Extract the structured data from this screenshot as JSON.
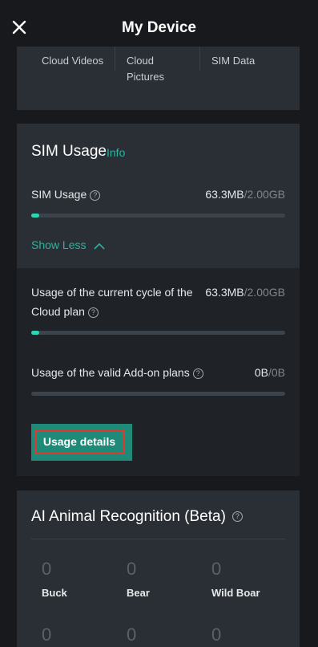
{
  "header": {
    "title": "My Device"
  },
  "cloud": {
    "columns": [
      {
        "label": "Cloud Videos"
      },
      {
        "label_line1": "Cloud",
        "label_line2": "Pictures"
      },
      {
        "label": "SIM Data"
      }
    ]
  },
  "sim": {
    "title": "SIM Usage",
    "info_label": "Info",
    "usage_label": "SIM Usage",
    "usage_used": "63.3MB",
    "usage_total": "/2.00GB",
    "usage_fraction": 0.031,
    "show_less_label": "Show Less",
    "cycle_label_line1": "Usage of the current cycle of the",
    "cycle_label_line2": "Cloud plan",
    "cycle_used": "63.3MB",
    "cycle_total": "/2.00GB",
    "cycle_fraction": 0.031,
    "addon_label": "Usage of the valid Add-on plans",
    "addon_used": "0B",
    "addon_total": "/0B",
    "addon_fraction": 0,
    "usage_details_label": "Usage details"
  },
  "ai": {
    "title": "AI Animal Recognition (Beta)",
    "animals": [
      {
        "name": "Buck",
        "count": "0"
      },
      {
        "name": "Bear",
        "count": "0"
      },
      {
        "name": "Wild Boar",
        "count": "0"
      }
    ],
    "next_row_counts": [
      "0",
      "0",
      "0"
    ]
  },
  "colors": {
    "accent": "#2bb39e",
    "bar_fill": "#2bd6b5",
    "button_bg": "#1f8a78",
    "highlight_border": "#e03a2f"
  },
  "icons": {
    "close": "close-icon",
    "help": "help-circle-icon",
    "chevron": "chevron-up-icon"
  }
}
